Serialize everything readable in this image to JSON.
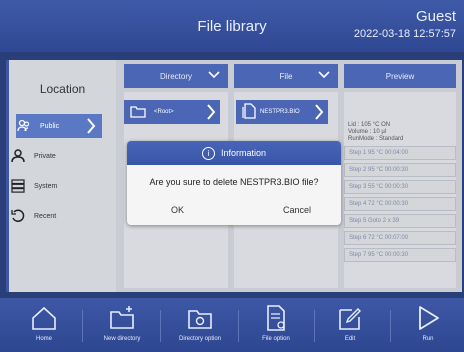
{
  "header": {
    "title": "File library",
    "user": "Guest",
    "datetime": "2022-03-18 12:57:57"
  },
  "sidebar": {
    "title": "Location",
    "items": [
      {
        "label": "Public",
        "icon": "group-icon",
        "active": true
      },
      {
        "label": "Private",
        "icon": "user-icon",
        "active": false
      },
      {
        "label": "System",
        "icon": "server-icon",
        "active": false
      },
      {
        "label": "Recent",
        "icon": "history-icon",
        "active": false
      }
    ]
  },
  "columns": {
    "directory": {
      "label": "Directory",
      "path": "<Root>"
    },
    "file": {
      "label": "File",
      "path": "NESTPR3.BIO"
    },
    "preview": {
      "label": "Preview"
    }
  },
  "preview": {
    "info": [
      "Lid : 105 °C  ON",
      "Volume : 10 µl",
      "RunMode : Standard"
    ],
    "steps": [
      "Step 1  95 °C 00:04:00",
      "Step 2  95 °C 00:00:30",
      "Step 3  55 °C 00:00:30",
      "Step 4  72 °C 00:00:30",
      "Step 5  Goto 2  x 39",
      "Step 6  72 °C 00:07:00",
      "Step 7  95 °C 00:00:30"
    ]
  },
  "dialog": {
    "title": "Information",
    "message": "Are you sure to delete  NESTPR3.BIO  file?",
    "ok_label": "OK",
    "cancel_label": "Cancel"
  },
  "toolbar": {
    "home": "Home",
    "new_directory": "New directory",
    "directory_option": "Directory option",
    "file_option": "File option",
    "edit": "Edit",
    "run": "Run"
  },
  "colors": {
    "header": "#3f5aa8",
    "accent": "#4a66b5",
    "panel": "#d8dadf"
  }
}
